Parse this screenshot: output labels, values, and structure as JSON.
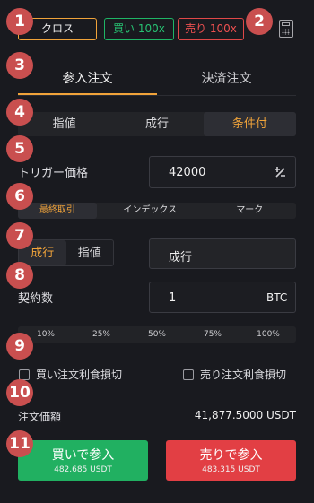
{
  "header": {
    "margin_mode": "クロス",
    "buy_chip": "買い 100x",
    "sell_chip": "売り 100x",
    "calculator_icon": "calculator-icon"
  },
  "badges": [
    "1",
    "2",
    "3",
    "4",
    "5",
    "6",
    "7",
    "8",
    "9",
    "10",
    "11"
  ],
  "tabs": {
    "entry": "参入注文",
    "settle": "決済注文"
  },
  "order_type": {
    "options": [
      "指値",
      "成行",
      "条件付"
    ],
    "active": "条件付"
  },
  "trigger": {
    "label": "トリガー価格",
    "value": "42000",
    "adjust_icon": "plus-minus-icon"
  },
  "trigger_source": {
    "options": [
      "最終取引",
      "インデックス",
      "マーク"
    ],
    "active": "最終取引"
  },
  "exec_type": {
    "options": [
      "成行",
      "指値"
    ],
    "active": "成行",
    "field_value": "成行"
  },
  "contracts": {
    "label": "契約数",
    "value": "1",
    "unit": "BTC"
  },
  "percent": [
    "10%",
    "25%",
    "50%",
    "75%",
    "100%"
  ],
  "tpsl": {
    "buy_label": "買い注文利食損切",
    "sell_label": "売り注文利食損切"
  },
  "order_value": {
    "label": "注文価額",
    "value": "41,877.5000 USDT"
  },
  "buttons": {
    "buy": {
      "label": "買いで参入",
      "sub": "482.685 USDT"
    },
    "sell": {
      "label": "売りで参入",
      "sub": "483.315 USDT"
    }
  },
  "colors": {
    "accent": "#f0a33a",
    "buy": "#21b061",
    "sell": "#e23f44",
    "badge": "#c94f4f"
  }
}
